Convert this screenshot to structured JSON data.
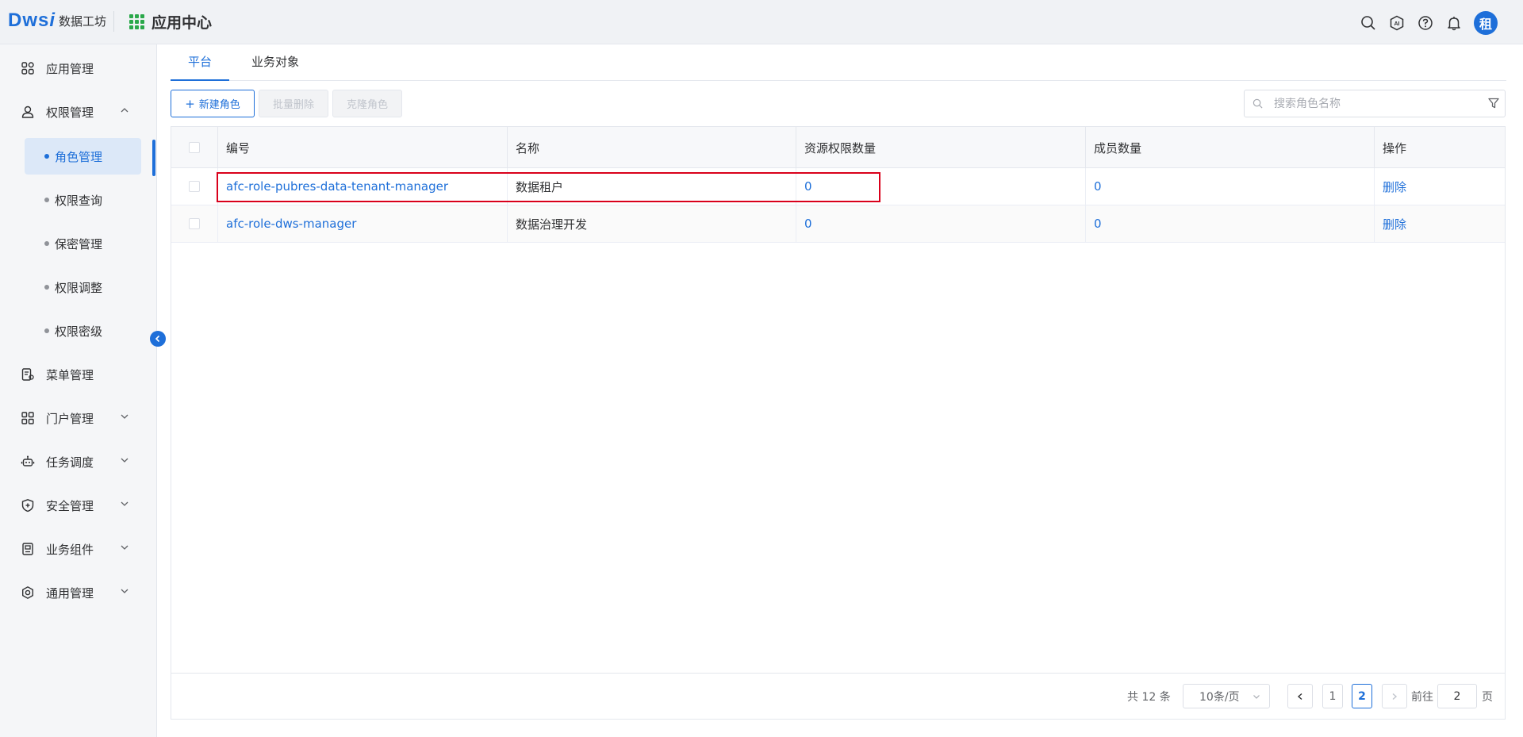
{
  "header": {
    "logo_mark": "Dws",
    "logo_i": "i",
    "logo_sub": "数据工坊",
    "app_center": "应用中心",
    "avatar_text": "租",
    "icons": [
      "search-icon",
      "ai-icon",
      "help-icon",
      "bell-icon"
    ]
  },
  "sidebar": {
    "items": [
      {
        "label": "应用管理",
        "icon": "apps-icon",
        "chevron": ""
      },
      {
        "label": "权限管理",
        "icon": "user-permission-icon",
        "chevron": "up"
      },
      {
        "label": "菜单管理",
        "icon": "menu-doc-icon",
        "chevron": ""
      },
      {
        "label": "门户管理",
        "icon": "portal-icon",
        "chevron": "down"
      },
      {
        "label": "任务调度",
        "icon": "robot-icon",
        "chevron": "down"
      },
      {
        "label": "安全管理",
        "icon": "shield-icon",
        "chevron": "down"
      },
      {
        "label": "业务组件",
        "icon": "component-icon",
        "chevron": "down"
      },
      {
        "label": "通用管理",
        "icon": "settings-icon",
        "chevron": "down"
      }
    ],
    "sub_items": [
      {
        "label": "角色管理",
        "active": true
      },
      {
        "label": "权限查询",
        "active": false
      },
      {
        "label": "保密管理",
        "active": false
      },
      {
        "label": "权限调整",
        "active": false
      },
      {
        "label": "权限密级",
        "active": false
      }
    ]
  },
  "tabs": [
    {
      "label": "平台",
      "active": true
    },
    {
      "label": "业务对象",
      "active": false
    }
  ],
  "toolbar": {
    "new_role": "新建角色",
    "batch_delete": "批量删除",
    "clone_role": "克隆角色",
    "search_placeholder": "搜索角色名称"
  },
  "table": {
    "columns": [
      "编号",
      "名称",
      "资源权限数量",
      "成员数量",
      "操作"
    ],
    "rows": [
      {
        "code": "afc-role-pubres-data-tenant-manager",
        "name": "数据租户",
        "resource_count": "0",
        "member_count": "0",
        "action": "删除"
      },
      {
        "code": "afc-role-dws-manager",
        "name": "数据治理开发",
        "resource_count": "0",
        "member_count": "0",
        "action": "删除"
      }
    ]
  },
  "pagination": {
    "total_text": "共 12 条",
    "page_size": "10条/页",
    "pages": [
      "1",
      "2"
    ],
    "current_page": "2",
    "goto_label": "前往",
    "goto_value": "2",
    "page_unit": "页"
  },
  "colors": {
    "accent": "#1e6fd9",
    "highlight_border": "#d9001b",
    "app_grid": "#2aa84a"
  }
}
